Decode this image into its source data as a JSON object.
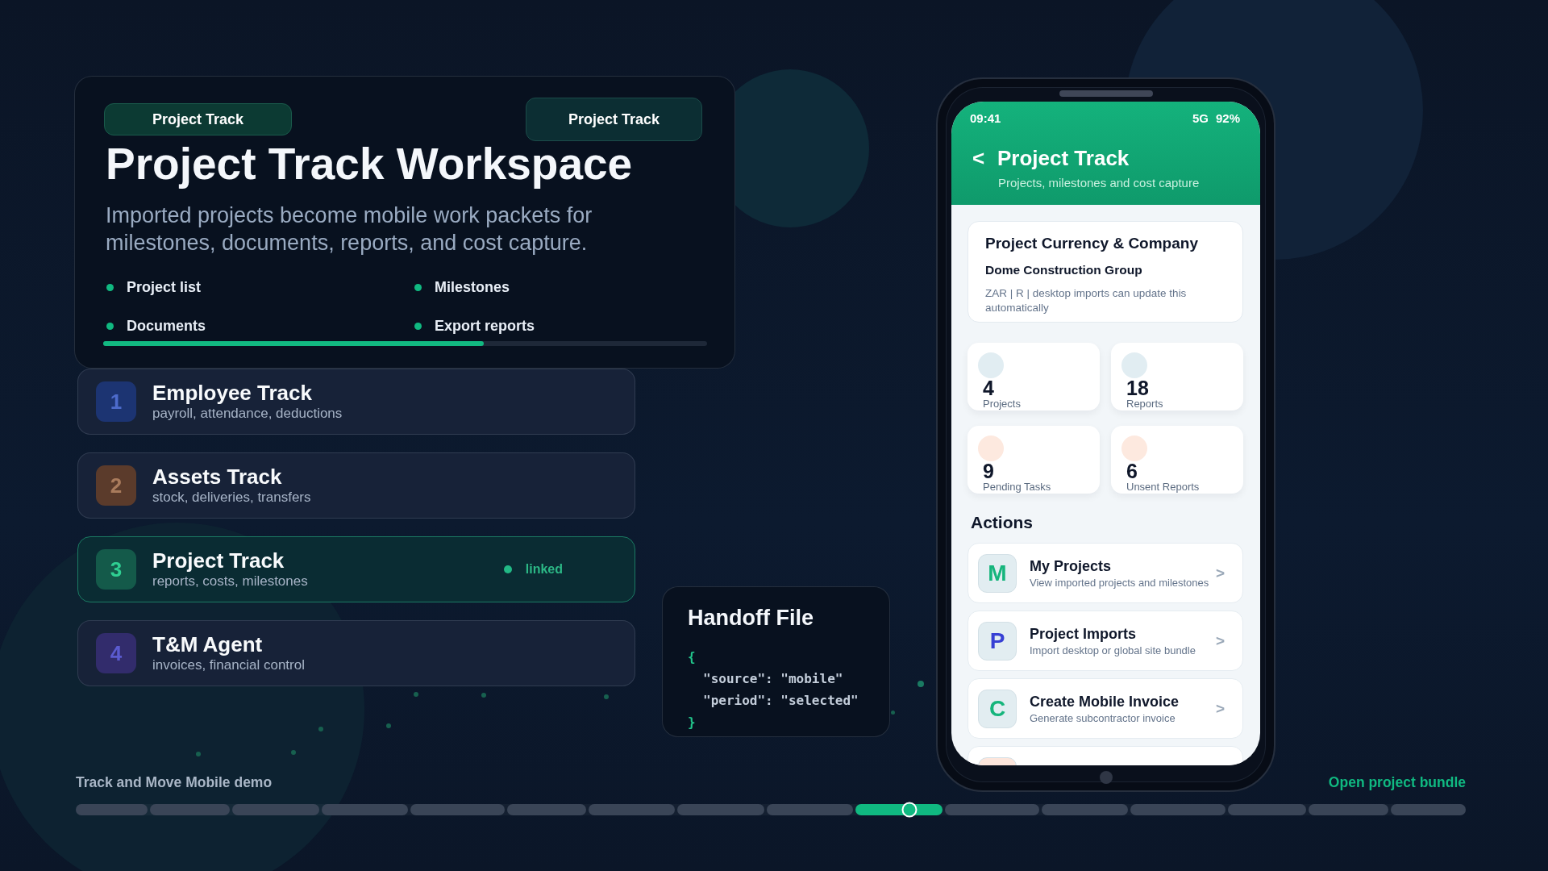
{
  "workspace": {
    "pills": [
      {
        "kind": "tag",
        "label": "Project Track"
      },
      {
        "kind": "button",
        "label": "Project Track"
      }
    ],
    "title": "Project Track Workspace",
    "description": "Imported projects become mobile work packets for milestones, documents, reports, and cost capture.",
    "features": [
      "Project list",
      "Milestones",
      "Documents",
      "Export reports"
    ],
    "progress": {
      "level": 0.63
    }
  },
  "tracks": [
    {
      "number": {
        "text": "1",
        "color": "#4d6bcb"
      },
      "title": "Employee Track",
      "subtitle": "payroll, attendance, deductions",
      "selected": false,
      "color": "#1c3472"
    },
    {
      "number": {
        "text": "2",
        "color": "#a97b5c"
      },
      "title": "Assets Track",
      "subtitle": "stock, deliveries, transfers",
      "selected": false,
      "color": "#5b3b2b"
    },
    {
      "number": {
        "text": "3",
        "color": "#2fcf92"
      },
      "title": "Project Track",
      "subtitle": "reports, costs, milestones",
      "selected": true,
      "status": "linked",
      "color": "#145a4a"
    },
    {
      "number": {
        "text": "4",
        "color": "#5b5bcf"
      },
      "title": "T&M Agent",
      "subtitle": "invoices, financial control",
      "selected": false,
      "color": "#322c6c"
    }
  ],
  "handoff_file": {
    "title": "Handoff File",
    "code": [
      {
        "kind": "brace",
        "text": "{"
      },
      {
        "kind": "entry",
        "text": "\"source\": \"mobile\""
      },
      {
        "kind": "entry",
        "text": "\"period\": \"selected\""
      },
      {
        "kind": "brace",
        "text": "}"
      }
    ]
  },
  "phone": {
    "status_bar": {
      "time": "09:41",
      "network": "5G",
      "battery": "92%"
    },
    "header": {
      "back": "<",
      "title": "Project Track",
      "subtitle": "Projects, milestones and cost capture"
    },
    "company_card": {
      "title": "Project Currency & Company",
      "company": "Dome Construction Group",
      "note": "ZAR | R | desktop imports can update this automatically"
    },
    "stats": [
      {
        "value": "4",
        "label": "Projects",
        "color": "#e1edf2"
      },
      {
        "value": "18",
        "label": "Reports",
        "color": "#e1edf2"
      },
      {
        "value": "9",
        "label": "Pending Tasks",
        "color": "#fde9df"
      },
      {
        "value": "6",
        "label": "Unsent Reports",
        "color": "#fde9df"
      }
    ],
    "actions_heading": "Actions",
    "actions": [
      {
        "title": "My Projects",
        "description": "View imported projects and milestones",
        "chevron": ">",
        "tile": {
          "color": "#e2edf1"
        },
        "icon": {
          "letter": "M",
          "color": "#16b57c"
        }
      },
      {
        "title": "Project Imports",
        "description": "Import desktop or global site bundle",
        "chevron": ">",
        "tile": {
          "color": "#e2edf1"
        },
        "icon": {
          "letter": "P",
          "color": "#3740d4"
        }
      },
      {
        "title": "Create Mobile Invoice",
        "description": "Generate subcontractor invoice",
        "chevron": ">",
        "tile": {
          "color": "#e2edf1"
        },
        "icon": {
          "letter": "C",
          "color": "#16b57c"
        }
      },
      {
        "tile": {
          "color": "#fde6dc"
        }
      }
    ]
  },
  "footer": {
    "caption": "Track and Move Mobile demo",
    "link": "Open project bundle",
    "timeline": {
      "level": 0.6,
      "segments": [
        {
          "selected": false
        },
        {
          "selected": false
        },
        {
          "selected": false
        },
        {
          "selected": false
        },
        {
          "selected": false
        },
        {
          "selected": false
        },
        {
          "selected": false
        },
        {
          "selected": false
        },
        {
          "selected": false
        },
        {
          "selected": true
        },
        {
          "selected": false
        },
        {
          "selected": false
        },
        {
          "selected": false
        },
        {
          "selected": false
        },
        {
          "selected": false
        },
        {
          "selected": false
        }
      ]
    }
  }
}
